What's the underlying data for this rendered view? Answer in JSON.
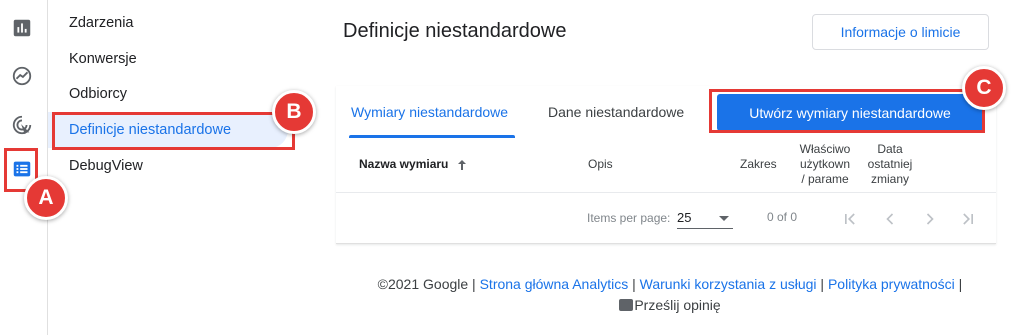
{
  "rail": {
    "icons": [
      "bar-chart-icon",
      "explore-icon",
      "advertising-icon",
      "configure-icon"
    ]
  },
  "nav": {
    "items": [
      {
        "label": "Zdarzenia"
      },
      {
        "label": "Konwersje"
      },
      {
        "label": "Odbiorcy"
      },
      {
        "label": "Definicje niestandardowe"
      },
      {
        "label": "DebugView"
      }
    ]
  },
  "header": {
    "title": "Definicje niestandardowe",
    "limits_button": "Informacje o limicie"
  },
  "tabs": [
    {
      "label": "Wymiary niestandardowe"
    },
    {
      "label": "Dane niestandardowe"
    }
  ],
  "create_button": "Utwórz wymiary niestandardowe",
  "table": {
    "columns": {
      "name": "Nazwa wymiaru",
      "description": "Opis",
      "scope": "Zakres",
      "property_line1": "Właściwo",
      "property_line2": "użytkown",
      "property_line3": "/ parame",
      "date_line1": "Data",
      "date_line2": "ostatniej",
      "date_line3": "zmiany"
    }
  },
  "pagination": {
    "items_per_page_label": "Items per page:",
    "items_per_page_value": "25",
    "range": "0 of 0"
  },
  "footer": {
    "copyright": "©2021 Google",
    "sep": " | ",
    "links": [
      "Strona główna Analytics",
      "Warunki korzystania z usługi",
      "Polityka prywatności"
    ],
    "feedback": "Prześlij opinię"
  },
  "annotations": {
    "a": "A",
    "b": "B",
    "c": "C"
  },
  "colors": {
    "accent": "#1a73e8",
    "annotation": "#e53935",
    "selected_bg": "#e8f0fe"
  }
}
